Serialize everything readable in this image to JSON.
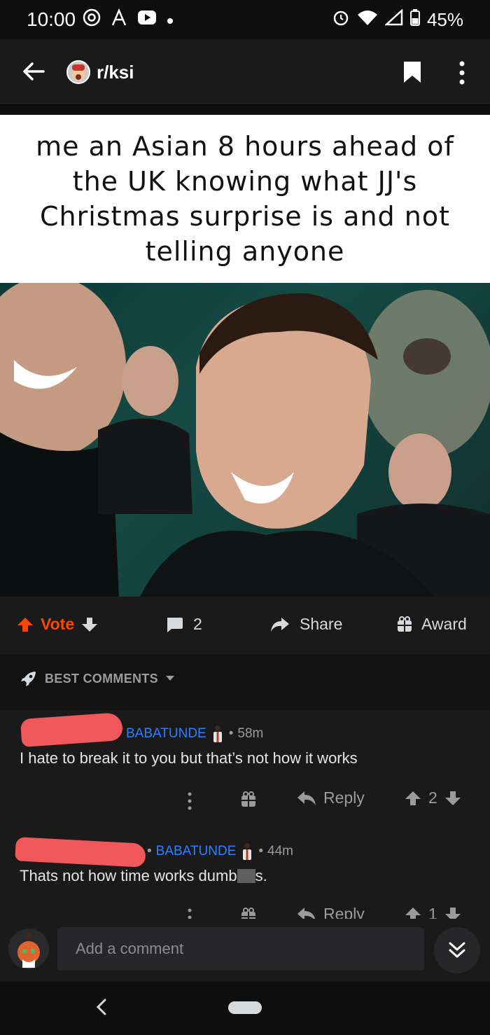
{
  "status_bar": {
    "time": "10:00",
    "left_icons": [
      "at-sign-icon",
      "font-a-icon",
      "youtube-icon",
      "dot-icon"
    ],
    "right_icons": [
      "alarm-icon",
      "wifi-icon",
      "signal-icon",
      "battery-icon"
    ],
    "battery": "45%",
    "battery_level": 0.45
  },
  "header": {
    "subreddit": "r/ksi",
    "back_icon": "arrow-left-icon",
    "bookmark_icon": "bookmark-icon",
    "more_icon": "more-vertical-icon"
  },
  "post": {
    "caption": "me an Asian 8 hours ahead of the UK knowing what JJ's Christmas surprise is and not telling anyone",
    "actions": {
      "vote_label": "Vote",
      "comment_count": "2",
      "share_label": "Share",
      "award_label": "Award"
    }
  },
  "sort": {
    "label": "BEST COMMENTS"
  },
  "comments": [
    {
      "flair": "BABATUNDE",
      "separator": "•",
      "time": "58m",
      "body": "I hate to break it to you but that’s not how it works",
      "reply_label": "Reply",
      "score": "2"
    },
    {
      "flair": "BABATUNDE",
      "separator": "•",
      "time": "44m",
      "body_before": "Thats not how time works dumb",
      "body_after": "s.",
      "reply_label": "Reply",
      "score": "1"
    }
  ],
  "composer": {
    "placeholder": "Add a comment"
  },
  "colors": {
    "upvote": "#ff4500",
    "flair_link": "#2f80ff",
    "background": "#1a1a1b",
    "redaction": "#f0585b"
  }
}
